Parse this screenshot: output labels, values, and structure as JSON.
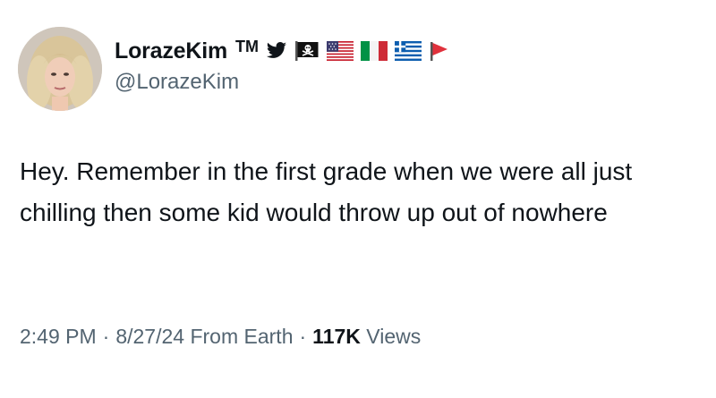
{
  "author": {
    "display_name": "LorazeKim",
    "tm": "TM",
    "handle": "@LorazeKim",
    "badges": [
      "twitter-bird-icon",
      "pirate-flag-icon",
      "us-flag-icon",
      "italy-flag-icon",
      "greece-flag-icon",
      "red-pennant-icon"
    ]
  },
  "tweet": {
    "text": "Hey. Remember in the first grade when we were all just chilling then some kid would throw up out of nowhere"
  },
  "meta": {
    "time": "2:49 PM",
    "separator": "·",
    "date": "8/27/24",
    "location": "From Earth",
    "views_count": "117K",
    "views_label": "Views"
  },
  "colors": {
    "text_primary": "#0f1419",
    "text_secondary": "#536471",
    "twitter_blue": "#1d9bf0"
  }
}
